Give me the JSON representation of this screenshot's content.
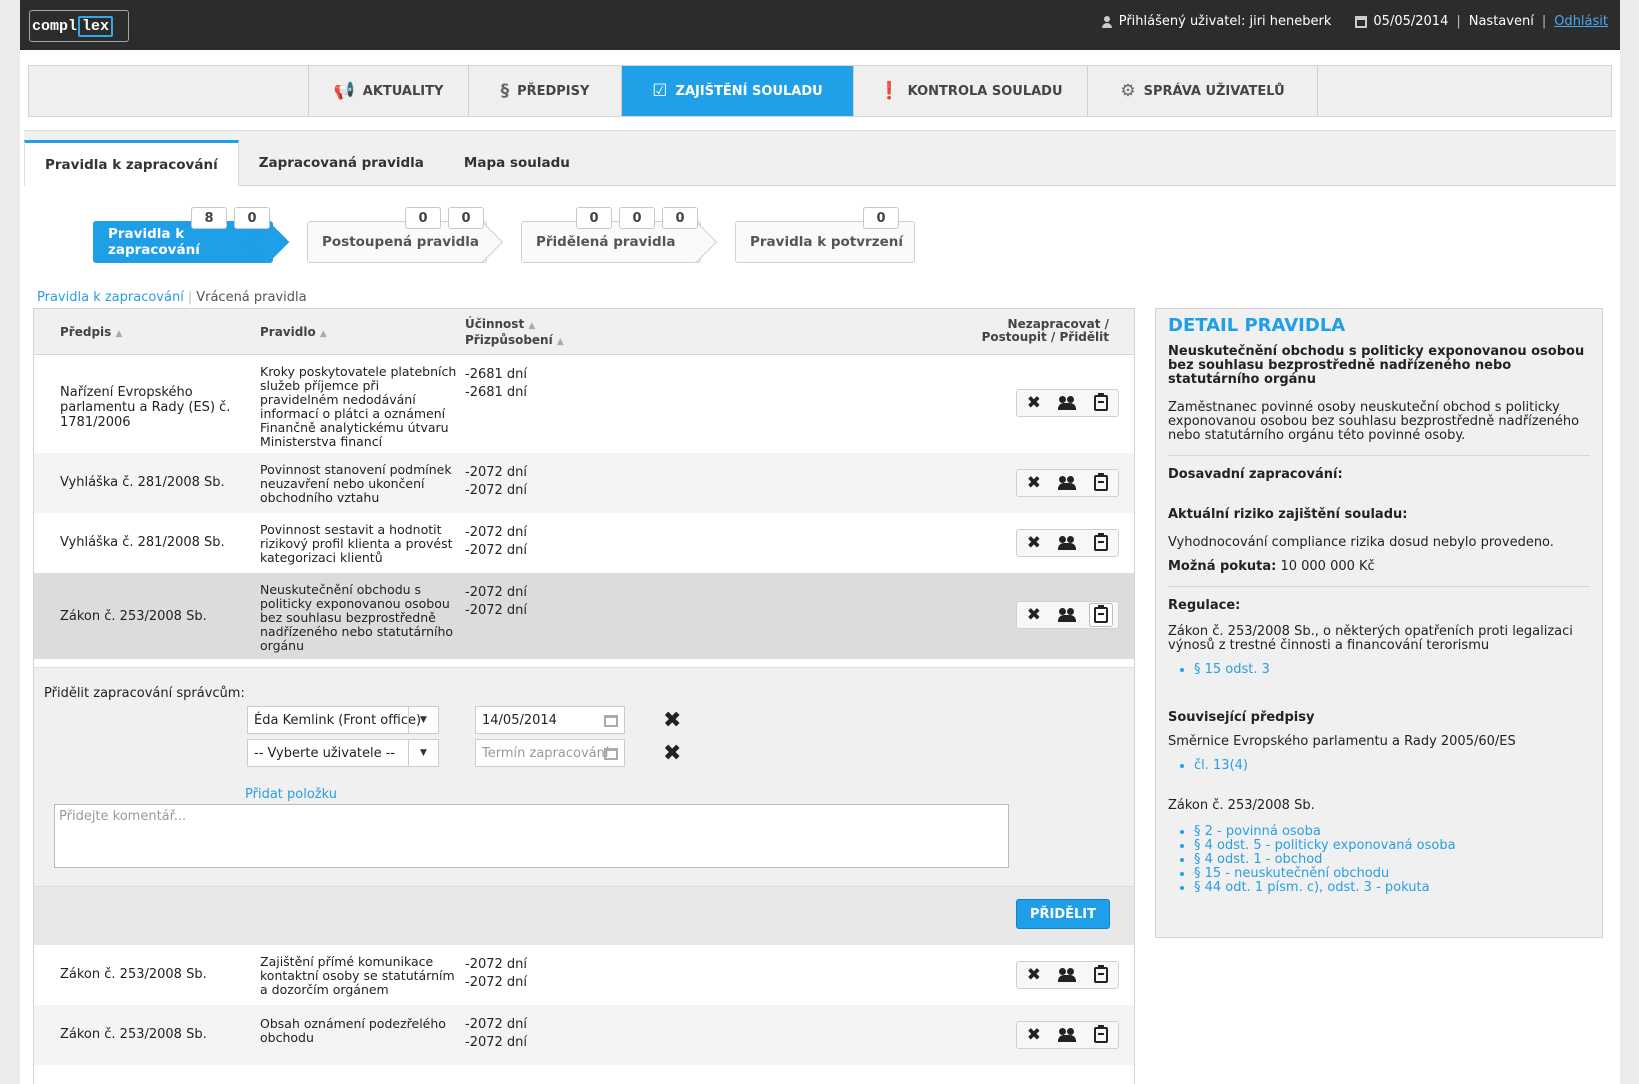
{
  "header": {
    "logo_text": "compl",
    "logo_accent": "lex",
    "user_label": "Přihlášený uživatel: jiri heneberk",
    "date": "05/05/2014",
    "settings": "Nastavení",
    "logout": "Odhlásit"
  },
  "main_nav": [
    {
      "label": "AKTUALITY",
      "icon": "megaphone-icon",
      "glyph": "📢"
    },
    {
      "label": "PŘEDPISY",
      "icon": "paragraph-icon",
      "glyph": "§"
    },
    {
      "label": "ZAJIŠTĚNÍ SOULADU",
      "icon": "checkbox-icon",
      "glyph": "☑",
      "active": true
    },
    {
      "label": "KONTROLA SOULADU",
      "icon": "alert-icon",
      "glyph": "❗"
    },
    {
      "label": "SPRÁVA UŽIVATELŮ",
      "icon": "gear-icon",
      "glyph": "⚙"
    }
  ],
  "sub_tabs": [
    "Pravidla k zapracování",
    "Zapracovaná pravidla",
    "Mapa souladu"
  ],
  "pipeline": [
    {
      "label": "Pravidla k zapracování",
      "badges": [
        "8",
        "0"
      ],
      "active": true
    },
    {
      "label": "Postoupená pravidla",
      "badges": [
        "0",
        "0"
      ]
    },
    {
      "label": "Přidělená pravidla",
      "badges": [
        "0",
        "0",
        "0"
      ]
    },
    {
      "label": "Pravidla k potvrzení",
      "badges": [
        "0"
      ]
    }
  ],
  "breadcrumbs": {
    "link": "Pravidla k zapracování",
    "current": "Vrácená pravidla"
  },
  "table": {
    "headers": {
      "predpis": "Předpis",
      "pravidlo": "Pravidlo",
      "ucinnost": "Účinnost",
      "prizpusobeni": "Přizpůsobení",
      "actions_line1": "Nezapracovat /",
      "actions_line2": "Postoupit / Přidělit"
    },
    "sort_arrow": "▲",
    "rows": [
      {
        "predpis": "Nařízení Evropského parlamentu a Rady (ES) č. 1781/2006",
        "pravidlo": "Kroky poskytovatele platebních služeb příjemce při pravidelném nedodávání informací o plátci a oznámení Finančně analytickému útvaru Ministerstva financí",
        "ucinnost": "-2681 dní",
        "prizpusobeni": "-2681 dní"
      },
      {
        "predpis": "Vyhláška č. 281/2008 Sb.",
        "pravidlo": "Povinnost stanovení podmínek neuzavření nebo ukončení obchodního vztahu",
        "ucinnost": "-2072 dní",
        "prizpusobeni": "-2072 dní"
      },
      {
        "predpis": "Vyhláška č. 281/2008 Sb.",
        "pravidlo": "Povinnost sestavit a hodnotit rizikový profil klienta a provést kategorizaci klientů",
        "ucinnost": "-2072 dní",
        "prizpusobeni": "-2072 dní"
      },
      {
        "predpis": "Zákon č. 253/2008 Sb.",
        "pravidlo": "Neuskutečnění obchodu s politicky exponovanou osobou bez souhlasu bezprostředně nadřízeného nebo statutárního orgánu",
        "ucinnost": "-2072 dní",
        "prizpusobeni": "-2072 dní"
      },
      {
        "predpis": "Zákon č. 253/2008 Sb.",
        "pravidlo": "Zajištění přímé komunikace kontaktní osoby se statutárním a dozorčím orgánem",
        "ucinnost": "-2072 dní",
        "prizpusobeni": "-2072 dní"
      },
      {
        "predpis": "Zákon č. 253/2008 Sb.",
        "pravidlo": "Obsah oznámení podezřelého obchodu",
        "ucinnost": "-2072 dní",
        "prizpusobeni": "-2072 dní"
      }
    ]
  },
  "assign": {
    "label": "Přidělit zapracování správcům:",
    "user1": "Éda Kemlink (Front office)",
    "date1": "14/05/2014",
    "user2": "-- Vyberte uživatele --",
    "date2_placeholder": "Termín zapracování",
    "add_item": "Přidat položku",
    "comment_placeholder": "Přidejte komentář...",
    "submit": "PŘIDĚLIT"
  },
  "detail": {
    "title": "DETAIL PRAVIDLA",
    "rule_name": "Neuskutečnění obchodu s politicky exponovanou osobou bez souhlasu bezprostředně nadřízeného nebo statutárního orgánu",
    "description": "Zaměstnanec povinné osoby neuskuteční obchod s politicky exponovanou osobou bez souhlasu bezprostředně nadřízeného nebo statutárního orgánu této povinné osoby.",
    "history_label": "Dosavadní zapracování:",
    "risk_label": "Aktuální riziko zajištění souladu:",
    "risk_text": "Vyhodnocování compliance rizika dosud nebylo provedeno.",
    "fine_label": "Možná pokuta:",
    "fine_value": "10 000 000 Kč",
    "regulation_label": "Regulace:",
    "regulation_text": "Zákon č. 253/2008 Sb., o některých opatřeních proti legalizaci výnosů z trestné činnosti a financování terorismu",
    "regulation_links": [
      "§ 15 odst. 3"
    ],
    "related_label": "Související předpisy",
    "related_1": "Směrnice Evropského parlamentu a Rady 2005/60/ES",
    "related_1_links": [
      "čl. 13(4)"
    ],
    "related_2": "Zákon č. 253/2008 Sb.",
    "related_2_links": [
      "§ 2 - povinná osoba",
      "§ 4 odst. 5 - politicky exponovaná osoba",
      "§ 4 odst. 1 - obchod",
      "§ 15 - neuskutečnění obchodu",
      "§ 44 odt. 1 písm. c), odst. 3 - pokuta"
    ]
  },
  "colors": {
    "accent": "#1e9fe8",
    "topbar": "#2c2c2c"
  }
}
